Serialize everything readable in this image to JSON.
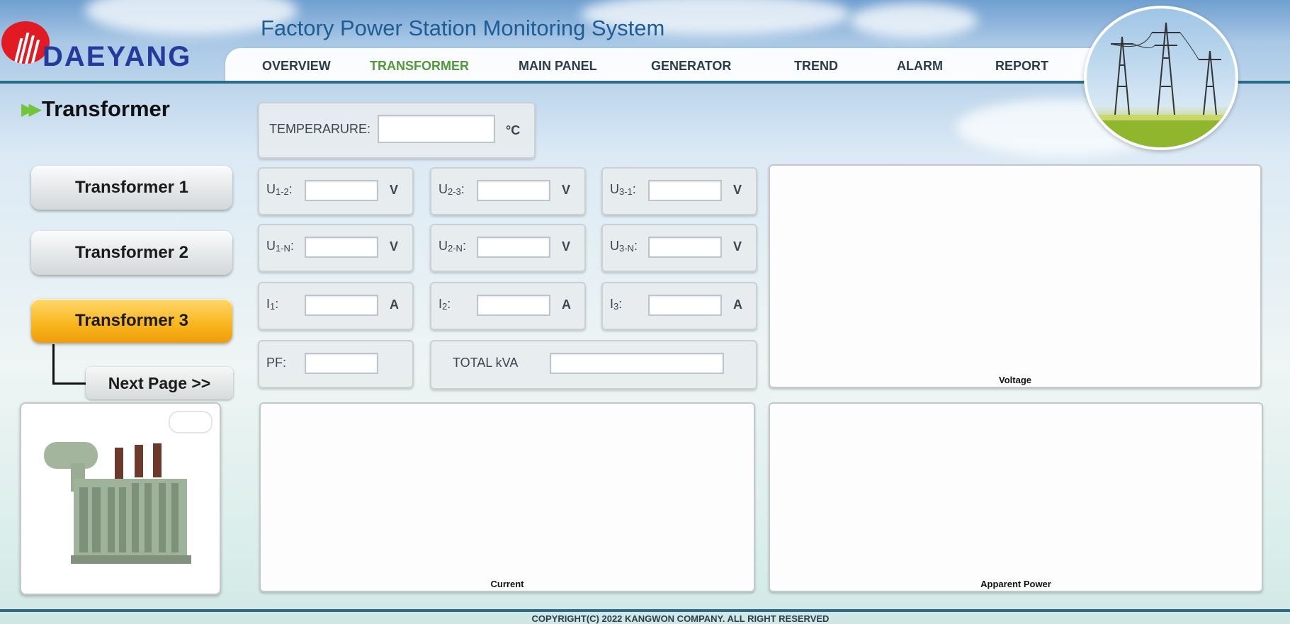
{
  "brand": {
    "name": "DAEYANG",
    "logo_color": "#e21b22",
    "name_color": "#243a9c"
  },
  "header": {
    "title": "Factory Power Station Monitoring System"
  },
  "nav": {
    "items": [
      "OVERVIEW",
      "TRANSFORMER",
      "MAIN PANEL",
      "GENERATOR",
      "TREND",
      "ALARM",
      "REPORT"
    ],
    "active": "TRANSFORMER",
    "active_color": "#4f9a3a"
  },
  "page": {
    "title": "Transformer"
  },
  "sidebar": {
    "buttons": [
      "Transformer 1",
      "Transformer 2",
      "Transformer 3"
    ],
    "active": "Transformer 3",
    "next_label": "Next Page >>"
  },
  "readings": {
    "temperature": {
      "label": "TEMPERARURE:",
      "unit": "°C",
      "value": ""
    },
    "u12": {
      "label": "U",
      "sub": "1-2",
      "suffix": ":",
      "unit": "V",
      "value": ""
    },
    "u23": {
      "label": "U",
      "sub": "2-3",
      "suffix": ":",
      "unit": "V",
      "value": ""
    },
    "u31": {
      "label": "U",
      "sub": "3-1",
      "suffix": ":",
      "unit": "V",
      "value": ""
    },
    "u1n": {
      "label": "U",
      "sub": "1-N",
      "suffix": ":",
      "unit": "V",
      "value": ""
    },
    "u2n": {
      "label": "U",
      "sub": "2-N",
      "suffix": ":",
      "unit": "V",
      "value": ""
    },
    "u3n": {
      "label": "U",
      "sub": "3-N",
      "suffix": ":",
      "unit": "V",
      "value": ""
    },
    "i1": {
      "label": "I",
      "sub": "1",
      "suffix": ":",
      "unit": "A",
      "value": ""
    },
    "i2": {
      "label": "I",
      "sub": "2",
      "suffix": ":",
      "unit": "A",
      "value": ""
    },
    "i3": {
      "label": "I",
      "sub": "3",
      "suffix": ":",
      "unit": "A",
      "value": ""
    },
    "pf": {
      "label": "PF:",
      "value": ""
    },
    "total_kva": {
      "label": "TOTAL kVA",
      "value": ""
    }
  },
  "charts": {
    "voltage": "Voltage",
    "current": "Current",
    "apparent_power": "Apparent Power"
  },
  "footer": {
    "copyright": "COPYRIGHT(C) 2022 KANGWON COMPANY. ALL RIGHT RESERVED"
  },
  "colors": {
    "nav_rule": "#2d6c88",
    "active_button": "#f8b51c"
  }
}
